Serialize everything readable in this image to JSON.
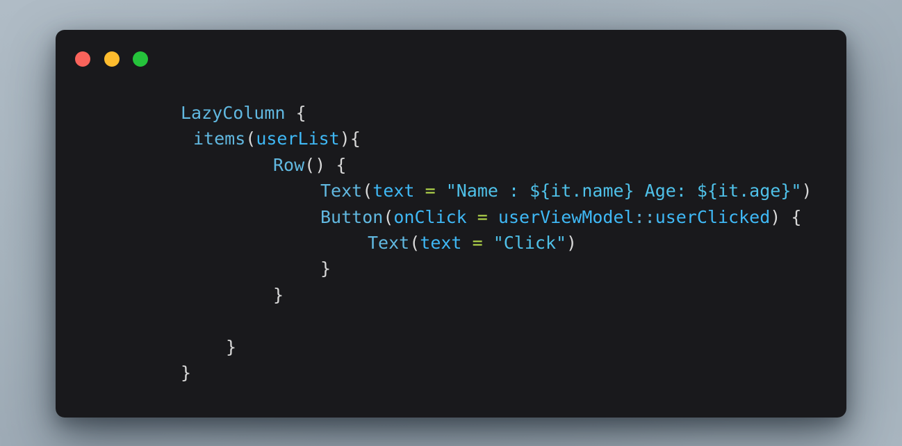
{
  "window": {
    "background_color": "#19191c",
    "page_background_color": "#a6b3bd",
    "traffic_lights": [
      {
        "name": "close",
        "color": "#f9635b"
      },
      {
        "name": "minimize",
        "color": "#febc2e"
      },
      {
        "name": "maximize",
        "color": "#25c33b"
      }
    ]
  },
  "code": {
    "language": "kotlin",
    "lines": [
      {
        "indent": 80,
        "tokens": [
          {
            "text": "LazyColumn",
            "type": "fn"
          },
          {
            "text": " ",
            "type": "plain"
          },
          {
            "text": "{",
            "type": "punc"
          }
        ]
      },
      {
        "indent": 98,
        "tokens": [
          {
            "text": "items",
            "type": "fn"
          },
          {
            "text": "(",
            "type": "punc"
          },
          {
            "text": "userList",
            "type": "param"
          },
          {
            "text": ")",
            "type": "punc"
          },
          {
            "text": "{",
            "type": "punc"
          }
        ]
      },
      {
        "indent": 213,
        "tokens": [
          {
            "text": "Row",
            "type": "fn"
          },
          {
            "text": "(",
            "type": "punc"
          },
          {
            "text": ")",
            "type": "punc"
          },
          {
            "text": " ",
            "type": "plain"
          },
          {
            "text": "{",
            "type": "punc"
          }
        ]
      },
      {
        "indent": 281,
        "tokens": [
          {
            "text": "Text",
            "type": "fn"
          },
          {
            "text": "(",
            "type": "punc"
          },
          {
            "text": "text",
            "type": "param"
          },
          {
            "text": " ",
            "type": "plain"
          },
          {
            "text": "=",
            "type": "op"
          },
          {
            "text": " ",
            "type": "plain"
          },
          {
            "text": "\"Name : ${it.name} Age: ${it.age}\"",
            "type": "str"
          },
          {
            "text": ")",
            "type": "punc"
          }
        ]
      },
      {
        "indent": 281,
        "tokens": [
          {
            "text": "Button",
            "type": "fn"
          },
          {
            "text": "(",
            "type": "punc"
          },
          {
            "text": "onClick",
            "type": "param"
          },
          {
            "text": " ",
            "type": "plain"
          },
          {
            "text": "=",
            "type": "op"
          },
          {
            "text": " ",
            "type": "plain"
          },
          {
            "text": "userViewModel",
            "type": "param"
          },
          {
            "text": "::",
            "type": "fn"
          },
          {
            "text": "userClicked",
            "type": "param"
          },
          {
            "text": ")",
            "type": "punc"
          },
          {
            "text": " ",
            "type": "plain"
          },
          {
            "text": "{",
            "type": "punc"
          }
        ]
      },
      {
        "indent": 349,
        "tokens": [
          {
            "text": "Text",
            "type": "fn"
          },
          {
            "text": "(",
            "type": "punc"
          },
          {
            "text": "text",
            "type": "param"
          },
          {
            "text": " ",
            "type": "plain"
          },
          {
            "text": "=",
            "type": "op"
          },
          {
            "text": " ",
            "type": "plain"
          },
          {
            "text": "\"Click\"",
            "type": "str"
          },
          {
            "text": ")",
            "type": "punc"
          }
        ]
      },
      {
        "indent": 281,
        "tokens": [
          {
            "text": "}",
            "type": "punc"
          }
        ]
      },
      {
        "indent": 213,
        "tokens": [
          {
            "text": "}",
            "type": "punc"
          }
        ]
      },
      {
        "indent": 0,
        "tokens": []
      },
      {
        "indent": 145,
        "tokens": [
          {
            "text": "}",
            "type": "punc"
          }
        ]
      },
      {
        "indent": 80,
        "tokens": [
          {
            "text": "}",
            "type": "punc"
          }
        ]
      }
    ]
  }
}
